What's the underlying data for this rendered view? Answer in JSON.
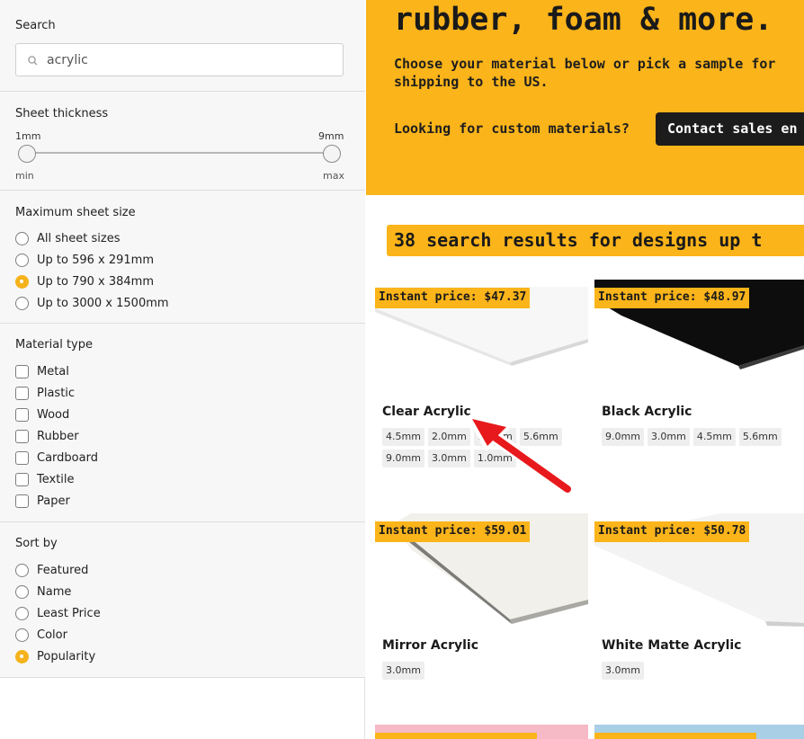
{
  "sidebar": {
    "search": {
      "title": "Search",
      "value": "acrylic"
    },
    "thickness": {
      "title": "Sheet thickness",
      "min_value": "1mm",
      "max_value": "9mm",
      "min_label": "min",
      "max_label": "max"
    },
    "sheet_size": {
      "title": "Maximum sheet size",
      "options": [
        {
          "label": "All sheet sizes",
          "selected": false
        },
        {
          "label": "Up to 596 x 291mm",
          "selected": false
        },
        {
          "label": "Up to 790 x 384mm",
          "selected": true
        },
        {
          "label": "Up to 3000 x 1500mm",
          "selected": false
        }
      ]
    },
    "material_type": {
      "title": "Material type",
      "options": [
        {
          "label": "Metal",
          "checked": false
        },
        {
          "label": "Plastic",
          "checked": false
        },
        {
          "label": "Wood",
          "checked": false
        },
        {
          "label": "Rubber",
          "checked": false
        },
        {
          "label": "Cardboard",
          "checked": false
        },
        {
          "label": "Textile",
          "checked": false
        },
        {
          "label": "Paper",
          "checked": false
        }
      ]
    },
    "sort_by": {
      "title": "Sort by",
      "options": [
        {
          "label": "Featured",
          "selected": false
        },
        {
          "label": "Name",
          "selected": false
        },
        {
          "label": "Least Price",
          "selected": false
        },
        {
          "label": "Color",
          "selected": false
        },
        {
          "label": "Popularity",
          "selected": true
        }
      ]
    }
  },
  "hero": {
    "title": "rubber, foam & more.",
    "subtitle": "Choose your material below or pick a sample for\nshipping to the US.",
    "custom_text": "Looking for custom materials?",
    "contact_button": "Contact sales en"
  },
  "results": {
    "heading": "38 search results for designs up t",
    "cards": [
      {
        "price": "Instant price: $47.37",
        "name": "Clear Acrylic",
        "thicknesses": [
          "4.5mm",
          "2.0mm",
          "1.5mm",
          "5.6mm",
          "9.0mm",
          "3.0mm",
          "1.0mm"
        ],
        "image": "clear-acrylic-sheet"
      },
      {
        "price": "Instant price: $48.97",
        "name": "Black Acrylic",
        "thicknesses": [
          "9.0mm",
          "3.0mm",
          "4.5mm",
          "5.6mm"
        ],
        "image": "black-acrylic-sheet"
      },
      {
        "price": "Instant price: $59.01",
        "name": "Mirror Acrylic",
        "thicknesses": [
          "3.0mm"
        ],
        "image": "mirror-acrylic-sheet"
      },
      {
        "price": "Instant price: $50.78",
        "name": "White Matte Acrylic",
        "thicknesses": [
          "3.0mm"
        ],
        "image": "white-matte-acrylic-sheet"
      }
    ]
  },
  "colors": {
    "accent": "#fbb41a",
    "dark": "#1c1c1c",
    "annotation_arrow": "#e8191c"
  }
}
